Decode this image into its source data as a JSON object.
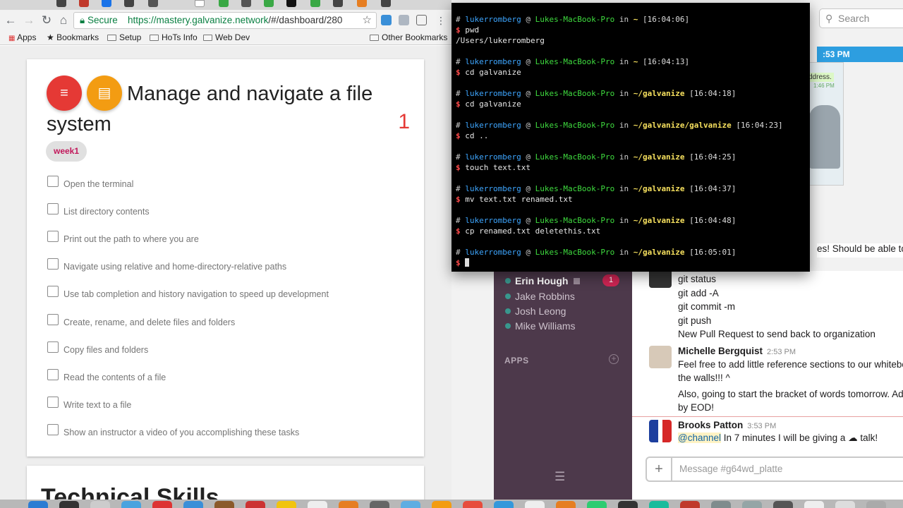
{
  "browser": {
    "secure_label": "Secure",
    "url_host": "https://mastery.galvanize.network",
    "url_path": "/#/dashboard/280",
    "bookmarks": [
      "Apps",
      "Bookmarks",
      "Setup",
      "HoTs Info",
      "Web Dev",
      "Other Bookmarks"
    ]
  },
  "card": {
    "title": "Manage and navigate a file system",
    "count": "1",
    "chip": "week1",
    "tasks": [
      "Open the terminal",
      "List directory contents",
      "Print out the path to where you are",
      "Navigate using relative and home-directory-relative paths",
      "Use tab completion and history navigation to speed up development",
      "Create, rename, and delete files and folders",
      "Copy files and folders",
      "Read the contents of a file",
      "Write text to a file",
      "Show an instructor a video of you accomplishing these tasks"
    ]
  },
  "next_card_title": "Technical Skills",
  "terminal": {
    "user": "lukerromberg",
    "host": "Lukes-MacBook-Pro",
    "entries": [
      {
        "path": "~",
        "time": "[16:04:06]",
        "cmd": "pwd",
        "out": "/Users/lukerromberg"
      },
      {
        "path": "~",
        "time": "[16:04:13]",
        "cmd": "cd galvanize",
        "out": ""
      },
      {
        "path": "~/galvanize",
        "time": "[16:04:18]",
        "cmd": "cd galvanize",
        "out": ""
      },
      {
        "path": "~/galvanize/galvanize",
        "time": "[16:04:23]",
        "cmd": "cd ..",
        "out": ""
      },
      {
        "path": "~/galvanize",
        "time": "[16:04:25]",
        "cmd": "touch text.txt",
        "out": ""
      },
      {
        "path": "~/galvanize",
        "time": "[16:04:37]",
        "cmd": "mv text.txt renamed.txt",
        "out": ""
      },
      {
        "path": "~/galvanize",
        "time": "[16:04:48]",
        "cmd": "cp renamed.txt deletethis.txt",
        "out": ""
      },
      {
        "path": "~/galvanize",
        "time": "[16:05:01]",
        "cmd": "",
        "out": ""
      }
    ]
  },
  "slack": {
    "search_placeholder": "Search",
    "banner_time": ":53 PM",
    "preview_text": "ddress.",
    "preview_time": "1:46 PM",
    "dms": [
      "Erin Hough",
      "Jake Robbins",
      "Josh Leong",
      "Mike Williams"
    ],
    "unread": "1",
    "apps_label": "APPS",
    "partial_line": "es! Should be able to ge",
    "commands": [
      "git status",
      "git add -A",
      "git commit -m",
      "git push",
      "New Pull Request to send back to organization"
    ],
    "michelle": {
      "name": "Michelle Bergquist",
      "time": "2:53 PM",
      "lines": [
        "Feel free to add little reference sections to our whitebo",
        "the walls!!! ^",
        "Also, going to start the bracket of words tomorrow. Add",
        "by EOD!"
      ]
    },
    "brooks": {
      "name": "Brooks Patton",
      "time": "3:53 PM",
      "mention": "@channel",
      "text": " In 7 minutes I will be giving a",
      "tail": "talk!"
    },
    "message_placeholder": "Message #g64wd_platte"
  }
}
